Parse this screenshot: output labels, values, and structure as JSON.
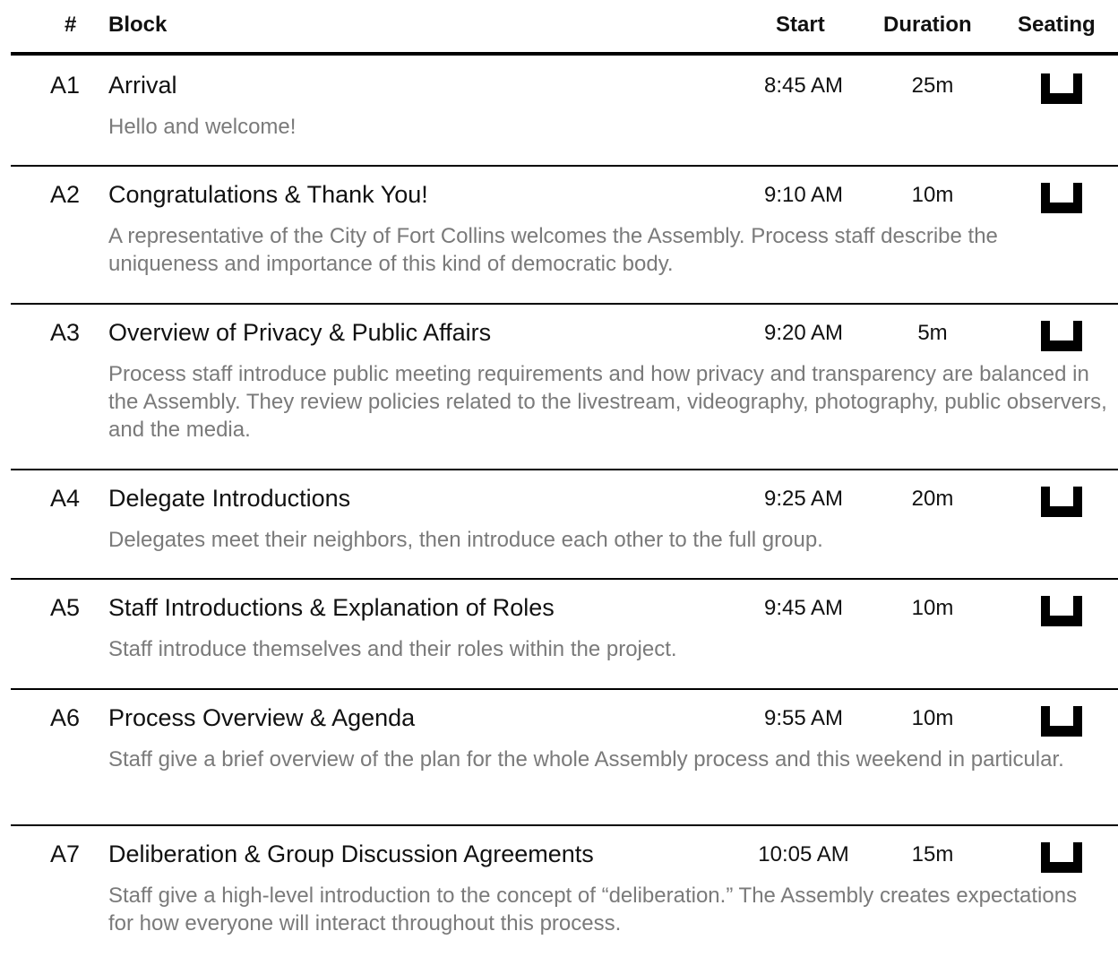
{
  "header": {
    "num": "#",
    "block": "Block",
    "start": "Start",
    "duration": "Duration",
    "seating": "Seating"
  },
  "rows": [
    {
      "num": "A1",
      "title": "Arrival",
      "start": "8:45 AM",
      "duration": "25m",
      "seating_icon": "table-seating-icon",
      "description": "Hello and welcome!"
    },
    {
      "num": "A2",
      "title": "Congratulations & Thank You!",
      "start": "9:10 AM",
      "duration": "10m",
      "seating_icon": "table-seating-icon",
      "description": "A representative of the City of Fort Collins welcomes the Assembly. Process staff describe the uniqueness and importance of this kind of democratic body."
    },
    {
      "num": "A3",
      "title": "Overview of Privacy & Public Affairs",
      "start": "9:20 AM",
      "duration": "5m",
      "seating_icon": "table-seating-icon",
      "description": "Process staff introduce public meeting requirements and how privacy and transparency are balanced in the Assembly. They review policies related to the livestream, videography, photography, public observers, and the media."
    },
    {
      "num": "A4",
      "title": "Delegate Introductions",
      "start": "9:25 AM",
      "duration": "20m",
      "seating_icon": "table-seating-icon",
      "description": "Delegates meet their neighbors, then introduce each other to the full group."
    },
    {
      "num": "A5",
      "title": "Staff Introductions & Explanation of Roles",
      "start": "9:45 AM",
      "duration": "10m",
      "seating_icon": "table-seating-icon",
      "description": "Staff introduce themselves and their roles within the project."
    },
    {
      "num": "A6",
      "title": "Process Overview & Agenda",
      "start": "9:55 AM",
      "duration": "10m",
      "seating_icon": "table-seating-icon",
      "description": "Staff give a brief overview of the plan for the whole Assembly process and this weekend in particular."
    },
    {
      "num": "A7",
      "title": "Deliberation & Group Discussion Agreements",
      "start": "10:05 AM",
      "duration": "15m",
      "seating_icon": "table-seating-icon",
      "description": "Staff give a high-level introduction to the concept of “deliberation.” The Assembly creates expectations for how everyone will interact throughout this process."
    }
  ]
}
